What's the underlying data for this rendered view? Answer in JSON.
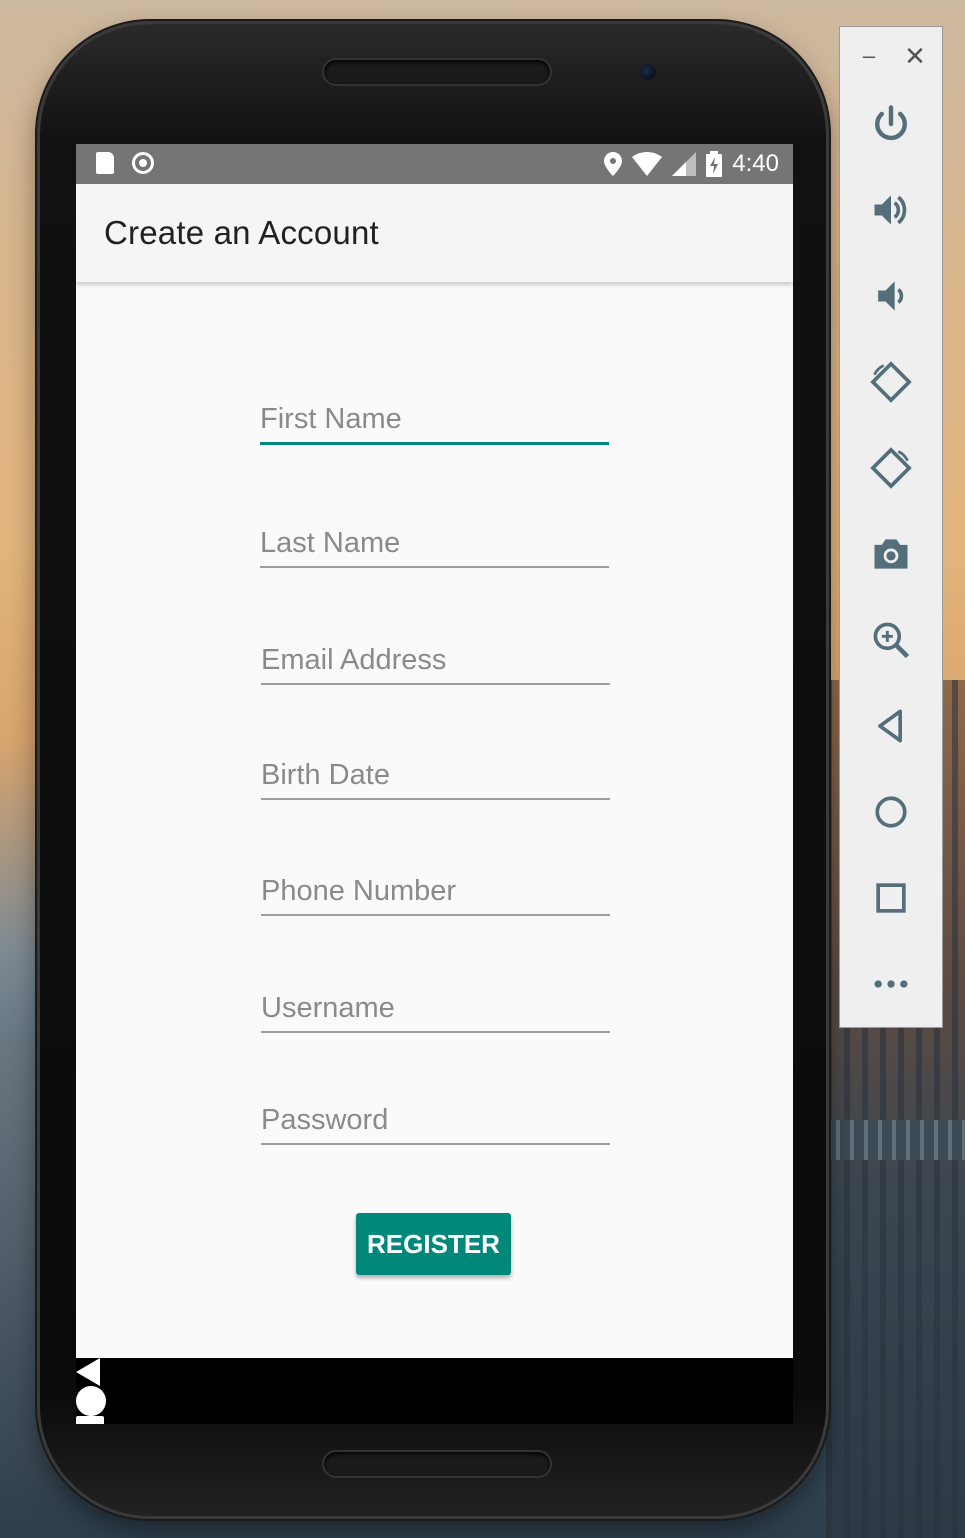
{
  "status_bar": {
    "time": "4:40",
    "icons_left": [
      "sd-card-icon",
      "recording-icon"
    ],
    "icons_right": [
      "location-icon",
      "wifi-icon",
      "signal-icon",
      "battery-charging-icon"
    ]
  },
  "app_bar": {
    "title": "Create an Account"
  },
  "form": {
    "fields": [
      {
        "hint": "First Name"
      },
      {
        "hint": "Last Name"
      },
      {
        "hint": "Email Address"
      },
      {
        "hint": "Birth Date"
      },
      {
        "hint": "Phone Number"
      },
      {
        "hint": "Username"
      },
      {
        "hint": "Password"
      }
    ],
    "register_label": "REGISTER"
  },
  "nav_bar": {
    "buttons": [
      "back-icon",
      "home-icon",
      "recents-icon"
    ]
  },
  "emulator_panel": {
    "window_controls": {
      "minimize": "–",
      "close": "✕"
    },
    "buttons": [
      "power-icon",
      "volume-up-icon",
      "volume-down-icon",
      "rotate-left-icon",
      "rotate-right-icon",
      "screenshot-camera-icon",
      "zoom-icon",
      "back-icon",
      "home-icon",
      "overview-icon",
      "more-icon"
    ]
  },
  "colors": {
    "accent": "#00897b",
    "status_bar": "#757575",
    "app_bar": "#f5f5f5"
  }
}
